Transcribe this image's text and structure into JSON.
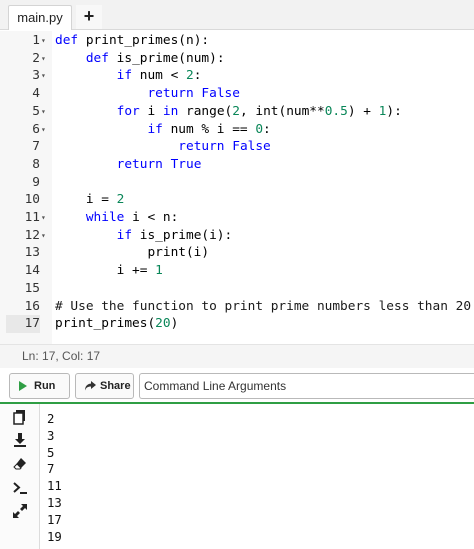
{
  "tab": {
    "name": "main.py",
    "add_label": "+"
  },
  "editor": {
    "lines": [
      {
        "n": "1",
        "fold": true
      },
      {
        "n": "2",
        "fold": true
      },
      {
        "n": "3",
        "fold": true
      },
      {
        "n": "4",
        "fold": false
      },
      {
        "n": "5",
        "fold": true
      },
      {
        "n": "6",
        "fold": true
      },
      {
        "n": "7",
        "fold": false
      },
      {
        "n": "8",
        "fold": false
      },
      {
        "n": "9",
        "fold": false
      },
      {
        "n": "10",
        "fold": false
      },
      {
        "n": "11",
        "fold": true
      },
      {
        "n": "12",
        "fold": true
      },
      {
        "n": "13",
        "fold": false
      },
      {
        "n": "14",
        "fold": false
      },
      {
        "n": "15",
        "fold": false
      },
      {
        "n": "16",
        "fold": false
      },
      {
        "n": "17",
        "fold": false
      }
    ],
    "code": [
      "def print_primes(n):",
      "    def is_prime(num):",
      "        if num < 2:",
      "            return False",
      "        for i in range(2, int(num**0.5) + 1):",
      "            if num % i == 0:",
      "                return False",
      "        return True",
      "",
      "    i = 2",
      "    while i < n:",
      "        if is_prime(i):",
      "            print(i)",
      "        i += 1",
      "",
      "# Use the function to print prime numbers less than 20",
      "print_primes(20)"
    ],
    "active_line": 17
  },
  "status": {
    "text": "Ln: 17,  Col: 17"
  },
  "toolbar": {
    "run_label": "Run",
    "share_label": "Share",
    "cmd_placeholder": "Command Line Arguments",
    "accent": "#2f9e44"
  },
  "output_tools": [
    "copy-icon",
    "download-icon",
    "eraser-icon",
    "terminal-icon",
    "expand-icon"
  ],
  "output": {
    "lines": [
      "2",
      "3",
      "5",
      "7",
      "11",
      "13",
      "17",
      "19"
    ]
  }
}
